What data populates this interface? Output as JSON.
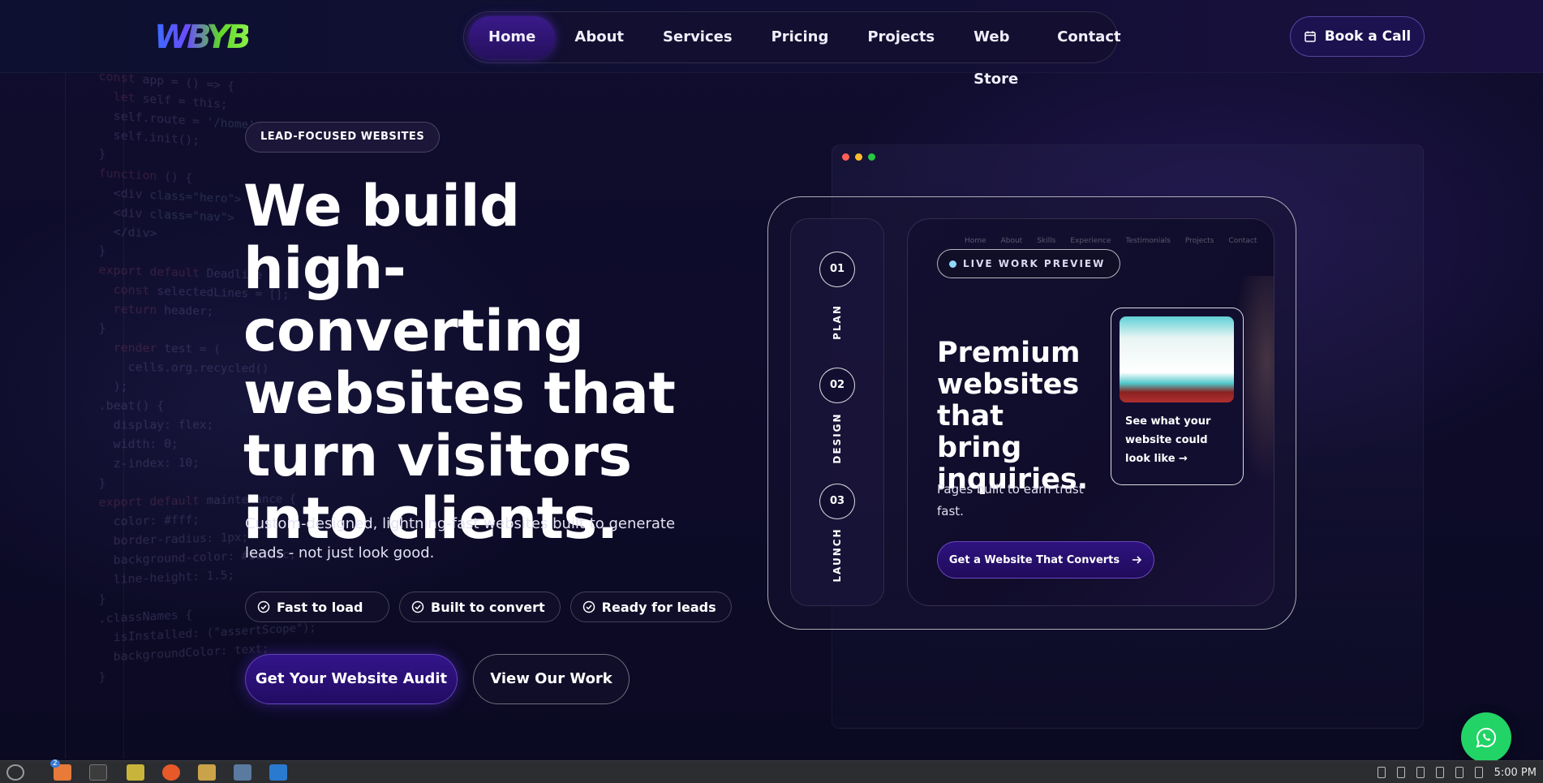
{
  "brand": {
    "logo_text": "WBYB"
  },
  "nav": {
    "items": [
      {
        "label": "Home",
        "active": true
      },
      {
        "label": "About"
      },
      {
        "label": "Services"
      },
      {
        "label": "Pricing"
      },
      {
        "label": "Projects"
      },
      {
        "label": "Web Store"
      },
      {
        "label": "Contact"
      }
    ],
    "cta_label": "Book a Call"
  },
  "hero": {
    "tag": "LEAD-FOCUSED WEBSITES",
    "headline": "We build high-converting websites that turn visitors into clients.",
    "subtext": "Custom-designed, lightning-fast websites built to generate leads - not just look good.",
    "chips": [
      "Fast to load",
      "Built to convert",
      "Ready for leads"
    ],
    "primary_cta": "Get Your Website Audit",
    "secondary_cta": "View Our Work"
  },
  "preview": {
    "steps": [
      {
        "num": "01",
        "label": "PLAN"
      },
      {
        "num": "02",
        "label": "DESIGN"
      },
      {
        "num": "03",
        "label": "LAUNCH"
      }
    ],
    "mini_nav": [
      "Home",
      "About",
      "Skills",
      "Experience",
      "Testimonials",
      "Projects",
      "Contact"
    ],
    "live_label": "LIVE WORK PREVIEW",
    "title": "Premium websites that bring inquiries.",
    "subtitle": "Pages built to earn trust fast.",
    "cta": "Get a Website That Converts",
    "thumb_caption": "See what your website could look like →"
  },
  "taskbar": {
    "clock": "5:00 PM",
    "badge_count": "2"
  },
  "colors": {
    "background": "#0c0a26",
    "accent": "#2e1380",
    "whatsapp": "#22d366"
  }
}
